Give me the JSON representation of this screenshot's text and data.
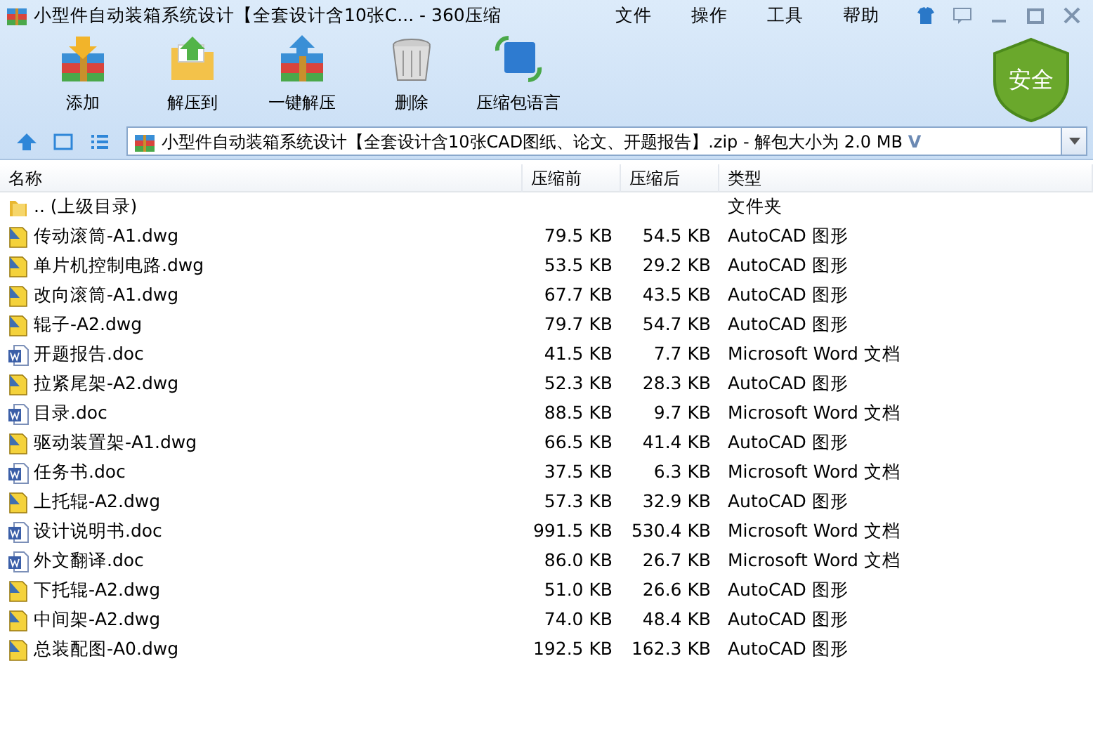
{
  "window": {
    "title": "小型件自动装箱系统设计【全套设计含10张C... - 360压缩"
  },
  "menu": [
    "文件",
    "操作",
    "工具",
    "帮助"
  ],
  "toolbar": [
    {
      "kind": "add",
      "label": "添加"
    },
    {
      "kind": "extract",
      "label": "解压到"
    },
    {
      "kind": "oneclick",
      "label": "一键解压"
    },
    {
      "kind": "delete",
      "label": "删除"
    },
    {
      "kind": "lang",
      "label": "压缩包语言"
    }
  ],
  "security_badge": "安全",
  "address": {
    "value": "小型件自动装箱系统设计【全套设计含10张CAD图纸、论文、开题报告】.zip - 解包大小为 2.0 MB",
    "caret": "V"
  },
  "table": {
    "columns": [
      "名称",
      "压缩前",
      "压缩后",
      "类型"
    ],
    "rows": [
      {
        "kind": "parent",
        "name": ".. (上级目录)",
        "size": "",
        "packed": "",
        "type": "文件夹"
      },
      {
        "kind": "dwg",
        "name": "传动滚筒-A1.dwg",
        "size": "79.5 KB",
        "packed": "54.5 KB",
        "type": "AutoCAD 图形"
      },
      {
        "kind": "dwg",
        "name": "单片机控制电路.dwg",
        "size": "53.5 KB",
        "packed": "29.2 KB",
        "type": "AutoCAD 图形"
      },
      {
        "kind": "dwg",
        "name": "改向滚筒-A1.dwg",
        "size": "67.7 KB",
        "packed": "43.5 KB",
        "type": "AutoCAD 图形"
      },
      {
        "kind": "dwg",
        "name": "辊子-A2.dwg",
        "size": "79.7 KB",
        "packed": "54.7 KB",
        "type": "AutoCAD 图形"
      },
      {
        "kind": "doc",
        "name": "开题报告.doc",
        "size": "41.5 KB",
        "packed": "7.7 KB",
        "type": "Microsoft Word 文档"
      },
      {
        "kind": "dwg",
        "name": "拉紧尾架-A2.dwg",
        "size": "52.3 KB",
        "packed": "28.3 KB",
        "type": "AutoCAD 图形"
      },
      {
        "kind": "doc",
        "name": "目录.doc",
        "size": "88.5 KB",
        "packed": "9.7 KB",
        "type": "Microsoft Word 文档"
      },
      {
        "kind": "dwg",
        "name": "驱动装置架-A1.dwg",
        "size": "66.5 KB",
        "packed": "41.4 KB",
        "type": "AutoCAD 图形"
      },
      {
        "kind": "doc",
        "name": "任务书.doc",
        "size": "37.5 KB",
        "packed": "6.3 KB",
        "type": "Microsoft Word 文档"
      },
      {
        "kind": "dwg",
        "name": "上托辊-A2.dwg",
        "size": "57.3 KB",
        "packed": "32.9 KB",
        "type": "AutoCAD 图形"
      },
      {
        "kind": "doc",
        "name": "设计说明书.doc",
        "size": "991.5 KB",
        "packed": "530.4 KB",
        "type": "Microsoft Word 文档"
      },
      {
        "kind": "doc",
        "name": "外文翻译.doc",
        "size": "86.0 KB",
        "packed": "26.7 KB",
        "type": "Microsoft Word 文档"
      },
      {
        "kind": "dwg",
        "name": "下托辊-A2.dwg",
        "size": "51.0 KB",
        "packed": "26.6 KB",
        "type": "AutoCAD 图形"
      },
      {
        "kind": "dwg",
        "name": "中间架-A2.dwg",
        "size": "74.0 KB",
        "packed": "48.4 KB",
        "type": "AutoCAD 图形"
      },
      {
        "kind": "dwg",
        "name": "总装配图-A0.dwg",
        "size": "192.5 KB",
        "packed": "162.3 KB",
        "type": "AutoCAD 图形"
      }
    ]
  }
}
